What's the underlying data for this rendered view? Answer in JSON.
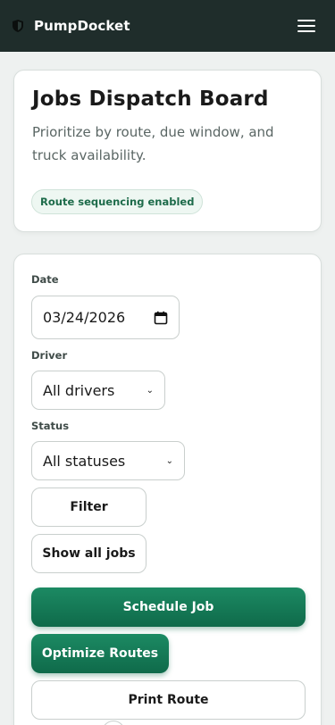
{
  "header": {
    "brand": "PumpDocket",
    "logo_icon": "shield-icon",
    "menu_icon": "hamburger-menu-icon"
  },
  "hero": {
    "title": "Jobs Dispatch Board",
    "subtitle": "Prioritize by route, due window, and truck availability.",
    "badge": "Route sequencing enabled"
  },
  "filters": {
    "date_label": "Date",
    "date_value": "03/24/2026",
    "driver_label": "Driver",
    "driver_value": "All drivers",
    "status_label": "Status",
    "status_value": "All statuses"
  },
  "actions": {
    "filter": "Filter",
    "show_all": "Show all jobs",
    "schedule": "Schedule Job",
    "optimize": "Optimize Routes",
    "print": "Print Route"
  },
  "colors": {
    "topbar": "#1f2d2b",
    "primary": "#0f6a4a",
    "badge_text": "#1d6b4a"
  }
}
